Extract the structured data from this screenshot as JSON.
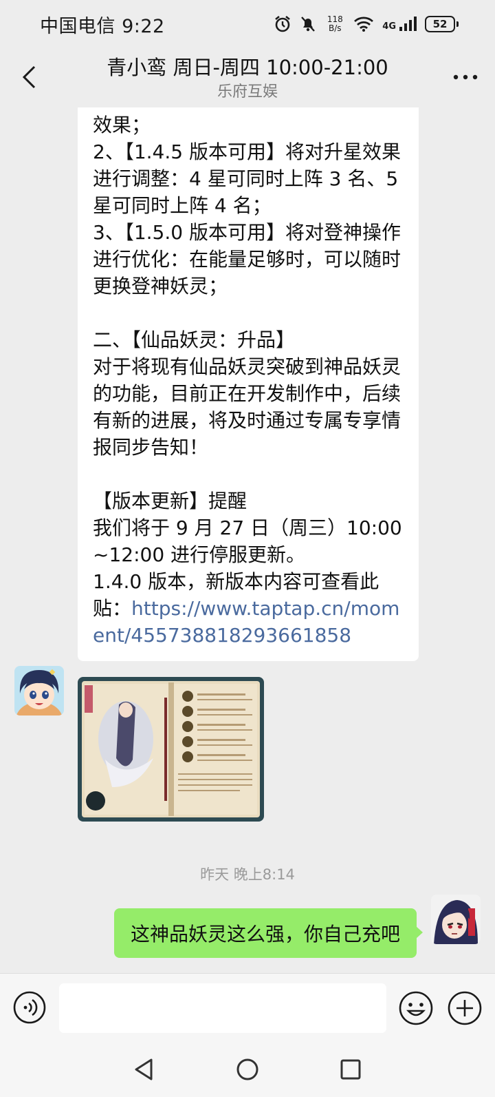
{
  "status_bar": {
    "carrier_time": "中国电信 9:22",
    "net_speed_value": "118",
    "net_speed_unit": "B/s",
    "net_type": "4G",
    "battery": "52"
  },
  "header": {
    "title": "青小鸾 周日-周四 10:00-21:00",
    "subtitle": "乐府互娱"
  },
  "messages": {
    "incoming_text": "效果；\n2、【1.4.5 版本可用】将对升星效果进行调整：4 星可同时上阵 3 名、5 星可同时上阵 4 名；\n3、【1.5.0 版本可用】将对登神操作进行优化：在能量足够时，可以随时更换登神妖灵；\n\n二、【仙品妖灵：升品】\n对于将现有仙品妖灵突破到神品妖灵的功能，目前正在开发制作中，后续有新的进展，将及时通过专属专享情报同步告知！\n\n【版本更新】提醒\n我们将于 9 月 27 日（周三）10:00~12:00 进行停服更新。\n1.4.0 版本，新版本内容可查看此贴：",
    "link": "https://www.taptap.cn/moment/455738818293661858",
    "timestamp": "昨天 晚上8:14",
    "outgoing_text": "这神品妖灵这么强，你自己充吧"
  },
  "input": {
    "placeholder": ""
  },
  "colors": {
    "background": "#ededed",
    "outgoing_bubble": "#95ec69",
    "incoming_bubble": "#ffffff",
    "link": "#4a6a9e"
  }
}
